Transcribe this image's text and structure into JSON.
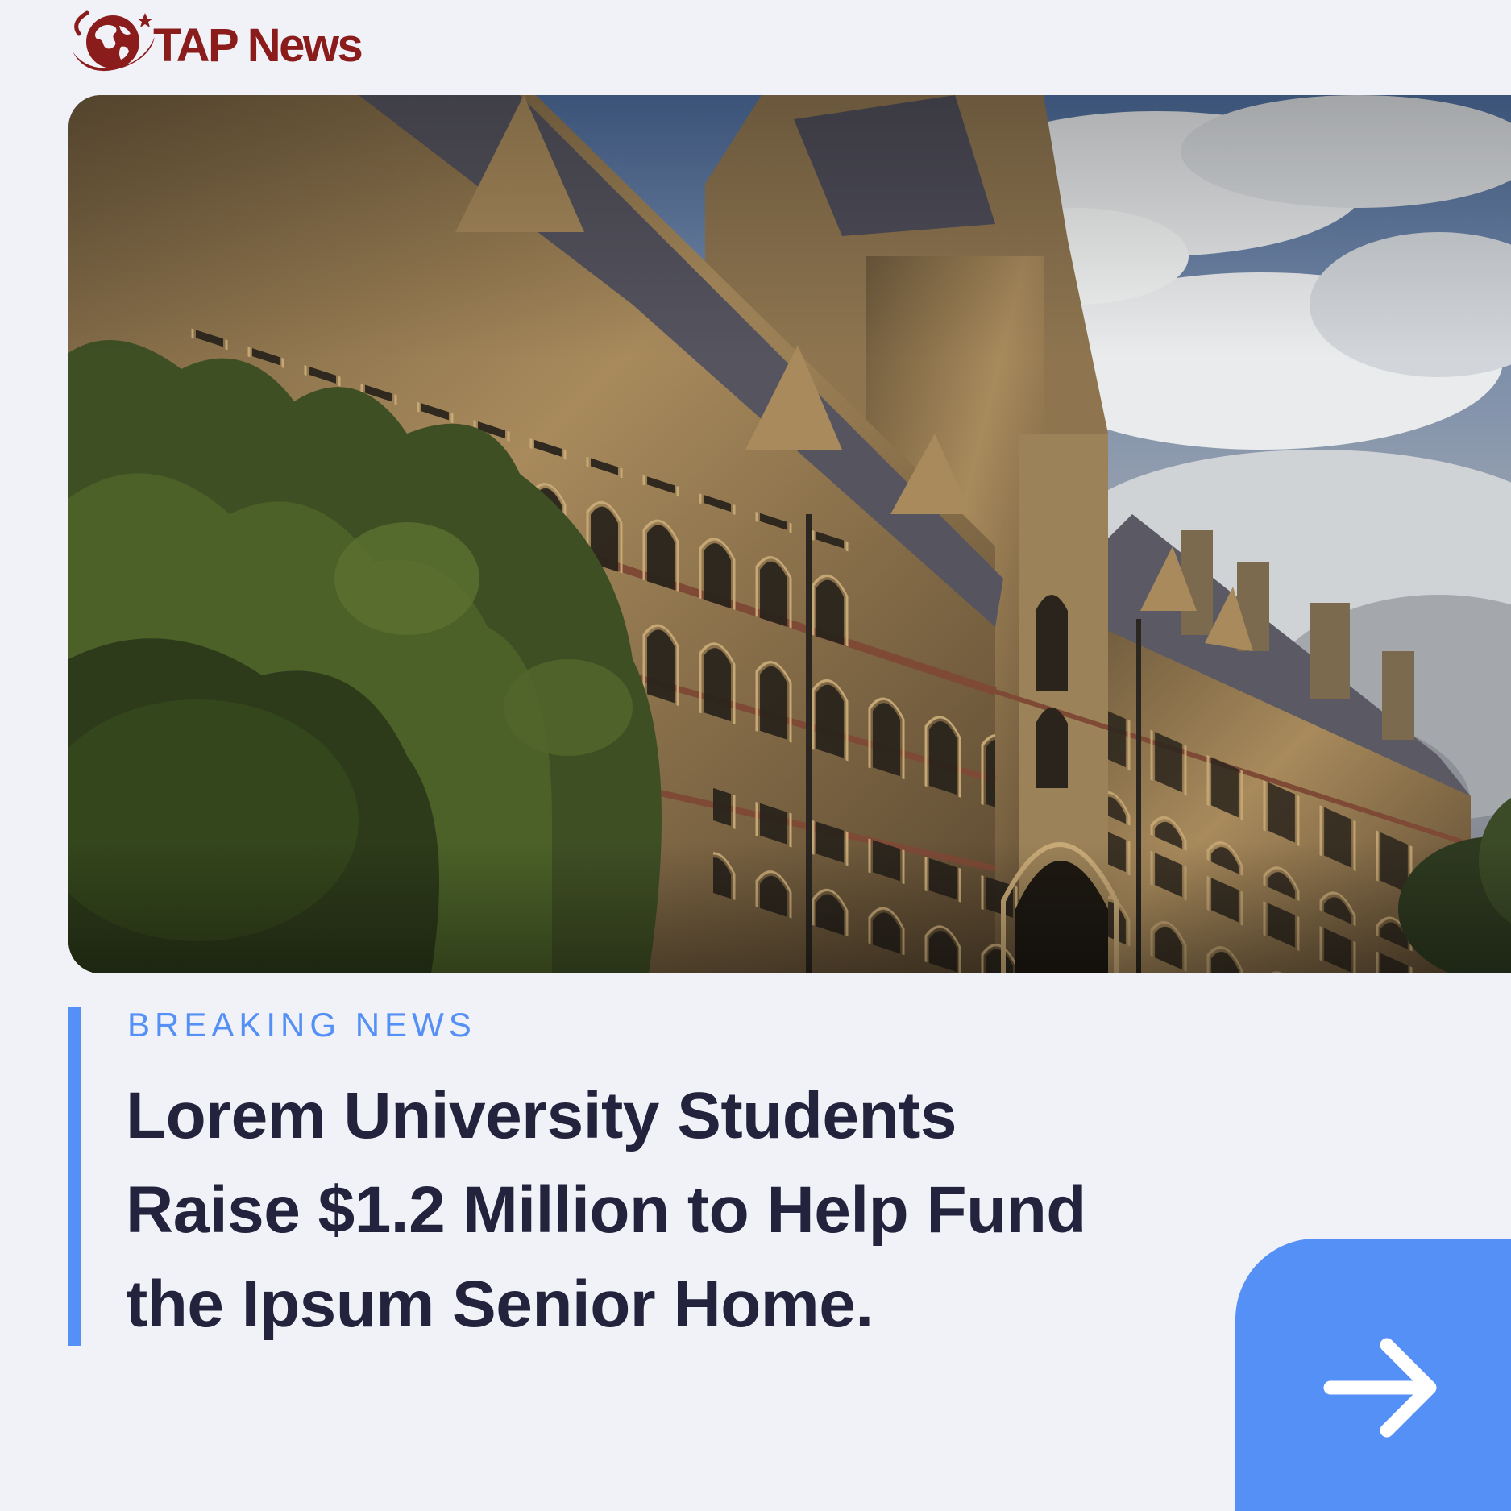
{
  "brand": {
    "name": "TAP News",
    "logo_icon": "globe-swoosh-icon",
    "color": "#8a1c1c"
  },
  "hero_image": {
    "description_icon": "gothic-university-building-photo"
  },
  "article": {
    "kicker": "BREAKING NEWS",
    "headline_lines": [
      "Lorem University Students",
      "Raise $1.2 Million to Help Fund",
      "the Ipsum Senior Home."
    ]
  },
  "next_button": {
    "icon": "arrow-right-icon"
  },
  "colors": {
    "background": "#f1f2f7",
    "accent": "#5590f6",
    "headline": "#24233d"
  }
}
